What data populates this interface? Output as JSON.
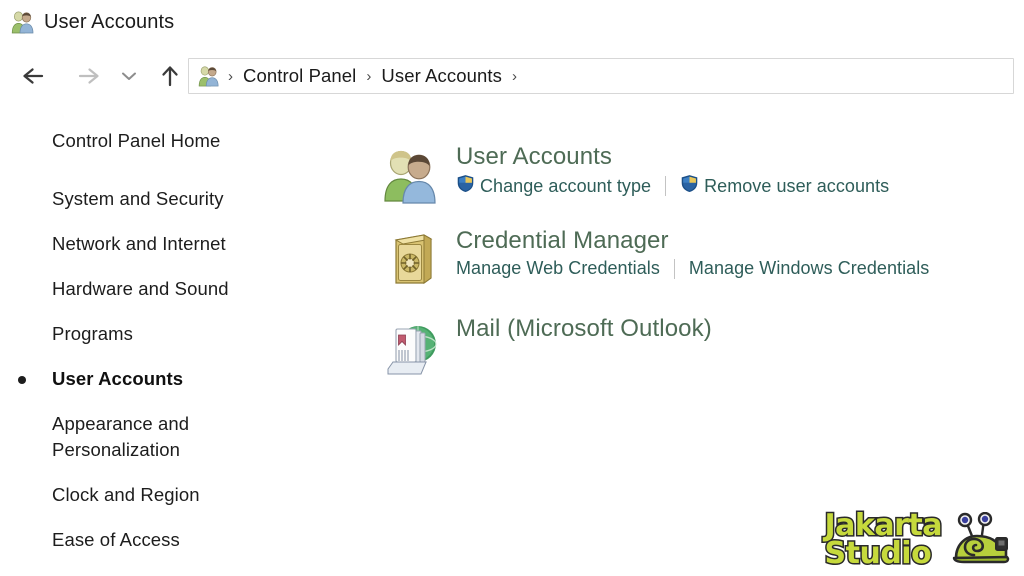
{
  "window": {
    "title": "User Accounts",
    "title_icon": "user-accounts-people-icon"
  },
  "navigation": {
    "back": {
      "icon": "back-arrow-icon",
      "label": "Back",
      "enabled": true
    },
    "forward": {
      "icon": "forward-arrow-icon",
      "label": "Forward",
      "enabled": false
    },
    "recent": {
      "icon": "chevron-down-icon",
      "label": "Recent locations"
    },
    "up": {
      "icon": "up-arrow-icon",
      "label": "Up one level",
      "enabled": true
    }
  },
  "address_bar": {
    "icon": "control-panel-people-icon",
    "separator": "›",
    "crumbs": [
      {
        "label": "Control Panel"
      },
      {
        "label": "User Accounts"
      }
    ],
    "trailing_separator": "›"
  },
  "sidebar": {
    "items": [
      {
        "label": "Control Panel Home",
        "current": false,
        "gap_after": true
      },
      {
        "label": "System and Security",
        "current": false
      },
      {
        "label": "Network and Internet",
        "current": false
      },
      {
        "label": "Hardware and Sound",
        "current": false
      },
      {
        "label": "Programs",
        "current": false
      },
      {
        "label": "User Accounts",
        "current": true
      },
      {
        "label": "Appearance and Personalization",
        "current": false
      },
      {
        "label": "Clock and Region",
        "current": false
      },
      {
        "label": "Ease of Access",
        "current": false
      }
    ]
  },
  "main": {
    "categories": [
      {
        "title": "User Accounts",
        "icon": "user-accounts-people-icon",
        "links": [
          {
            "label": "Change account type",
            "shield": true
          },
          {
            "label": "Remove user accounts",
            "shield": true
          }
        ]
      },
      {
        "title": "Credential Manager",
        "icon": "credential-vault-icon",
        "links": [
          {
            "label": "Manage Web Credentials",
            "shield": false
          },
          {
            "label": "Manage Windows Credentials",
            "shield": false
          }
        ]
      },
      {
        "title": "Mail (Microsoft Outlook)",
        "icon": "mail-outlook-icon",
        "links": []
      }
    ]
  },
  "watermark": {
    "line1": "Jakarta",
    "line2": "Studio",
    "logo": "snail-logo-icon"
  },
  "colors": {
    "heading": "#4e6b55",
    "link": "#2e5d59",
    "text": "#1d1d1d",
    "address_border": "#d7d7d7",
    "watermark_fill": "#c6d93c",
    "watermark_stroke": "#2a2a2a"
  }
}
